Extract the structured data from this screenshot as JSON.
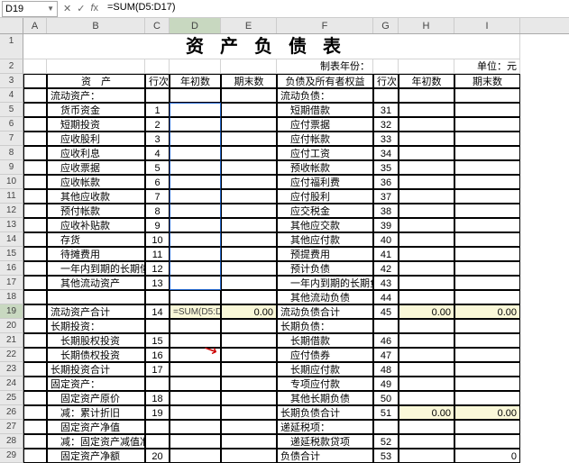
{
  "cell_ref": "D19",
  "formula": "=SUM(D5:D17)",
  "columns": [
    "A",
    "B",
    "C",
    "D",
    "E",
    "F",
    "G",
    "H",
    "I"
  ],
  "selected_col": "D",
  "selected_row": 19,
  "title": "资产负债表",
  "period_label": "制表年份：",
  "unit_label": "单位：元",
  "headers": {
    "b": "资　产",
    "c": "行次",
    "d": "年初数",
    "e": "期末数",
    "f": "负债及所有者权益",
    "g": "行次",
    "h": "年初数",
    "i": "期末数"
  },
  "chart_data": {
    "type": "table",
    "rows": [
      {
        "r": 4,
        "b": "流动资产：",
        "c": "",
        "f": "流动负债：",
        "g": ""
      },
      {
        "r": 5,
        "b": "货币资金",
        "c": "1",
        "f": "短期借款",
        "g": "31"
      },
      {
        "r": 6,
        "b": "短期投资",
        "c": "2",
        "f": "应付票据",
        "g": "32"
      },
      {
        "r": 7,
        "b": "应收股利",
        "c": "3",
        "f": "应付帐款",
        "g": "33"
      },
      {
        "r": 8,
        "b": "应收利息",
        "c": "4",
        "f": "应付工资",
        "g": "34"
      },
      {
        "r": 9,
        "b": "应收票据",
        "c": "5",
        "f": "预收帐款",
        "g": "35"
      },
      {
        "r": 10,
        "b": "应收帐款",
        "c": "6",
        "f": "应付福利费",
        "g": "36"
      },
      {
        "r": 11,
        "b": "其他应收款",
        "c": "7",
        "f": "应付股利",
        "g": "37"
      },
      {
        "r": 12,
        "b": "预付帐款",
        "c": "8",
        "f": "应交税金",
        "g": "38"
      },
      {
        "r": 13,
        "b": "应收补贴款",
        "c": "9",
        "f": "其他应交款",
        "g": "39"
      },
      {
        "r": 14,
        "b": "存货",
        "c": "10",
        "f": "其他应付款",
        "g": "40"
      },
      {
        "r": 15,
        "b": "待摊费用",
        "c": "11",
        "f": "预提费用",
        "g": "41"
      },
      {
        "r": 16,
        "b": "一年内到期的长期债权投资",
        "c": "12",
        "f": "预计负债",
        "g": "42"
      },
      {
        "r": 17,
        "b": "其他流动资产",
        "c": "13",
        "f": "一年内到期的长期负债",
        "g": "43"
      },
      {
        "r": 18,
        "b": "",
        "c": "",
        "f": "其他流动负债",
        "g": "44"
      },
      {
        "r": 19,
        "b": "流动资产合计",
        "c": "14",
        "d": "=SUM(D5:D17)",
        "e": "0.00",
        "f": "流动负债合计",
        "g": "45",
        "h": "0.00",
        "i": "0.00",
        "yellow": true
      },
      {
        "r": 20,
        "b": "长期投资：",
        "c": "",
        "f": "长期负债：",
        "g": ""
      },
      {
        "r": 21,
        "b": "长期股权投资",
        "c": "15",
        "f": "长期借款",
        "g": "46"
      },
      {
        "r": 22,
        "b": "长期债权投资",
        "c": "16",
        "f": "应付债券",
        "g": "47"
      },
      {
        "r": 23,
        "b": "长期投资合计",
        "c": "17",
        "f": "长期应付款",
        "g": "48"
      },
      {
        "r": 24,
        "b": "固定资产：",
        "c": "",
        "f": "专项应付款",
        "g": "49"
      },
      {
        "r": 25,
        "b": "固定资产原价",
        "c": "18",
        "f": "其他长期负债",
        "g": "50"
      },
      {
        "r": 26,
        "b": "减：累计折旧",
        "c": "19",
        "f": "长期负债合计",
        "g": "51",
        "h": "0.00",
        "i": "0.00",
        "yellow_h": true
      },
      {
        "r": 27,
        "b": "固定资产净值",
        "c": "",
        "f": "递延税项：",
        "g": ""
      },
      {
        "r": 28,
        "b": "减：固定资产减值准备",
        "c": "",
        "f": "递延税款贷项",
        "g": "52"
      },
      {
        "r": 29,
        "b": "固定资产净额",
        "c": "20",
        "f": "负债合计",
        "g": "53",
        "h": "",
        "i": "0"
      }
    ]
  }
}
